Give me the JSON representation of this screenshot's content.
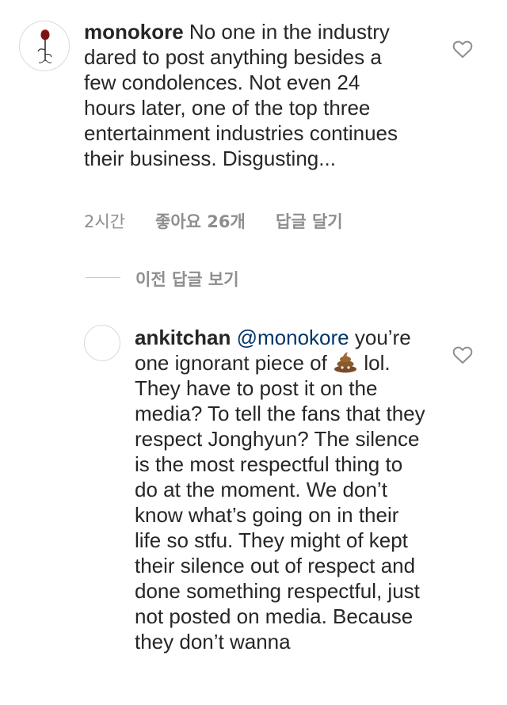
{
  "comments": [
    {
      "username": "monokore",
      "text": "No one in the industry dared to post anything besides a few condolences. Not even 24 hours later, one of the top three entertainment industries continues their business. Disgusting...",
      "time": "2시간",
      "likes": "좋아요 26개",
      "reply_label": "답글 달기",
      "avatar_icon": "rose-icon"
    }
  ],
  "replies_toggle": {
    "label": "이전 답글 보기"
  },
  "reply": {
    "username": "ankitchan",
    "mention": "@monokore",
    "text_before_emoji": "you’re one ignorant piece of",
    "emoji_icon": "poop-emoji-icon",
    "text_after_emoji": "lol. They have to post it on the media? To tell the fans that they respect Jonghyun? The silence is the most respectful thing to do at the moment. We don’t know what’s going on in their life so stfu. They might of kept their silence out of respect and done something respectful, just not posted on media. Because they don’t wanna"
  },
  "colors": {
    "text": "#262626",
    "muted": "#8e8e8e",
    "mention": "#003569"
  }
}
